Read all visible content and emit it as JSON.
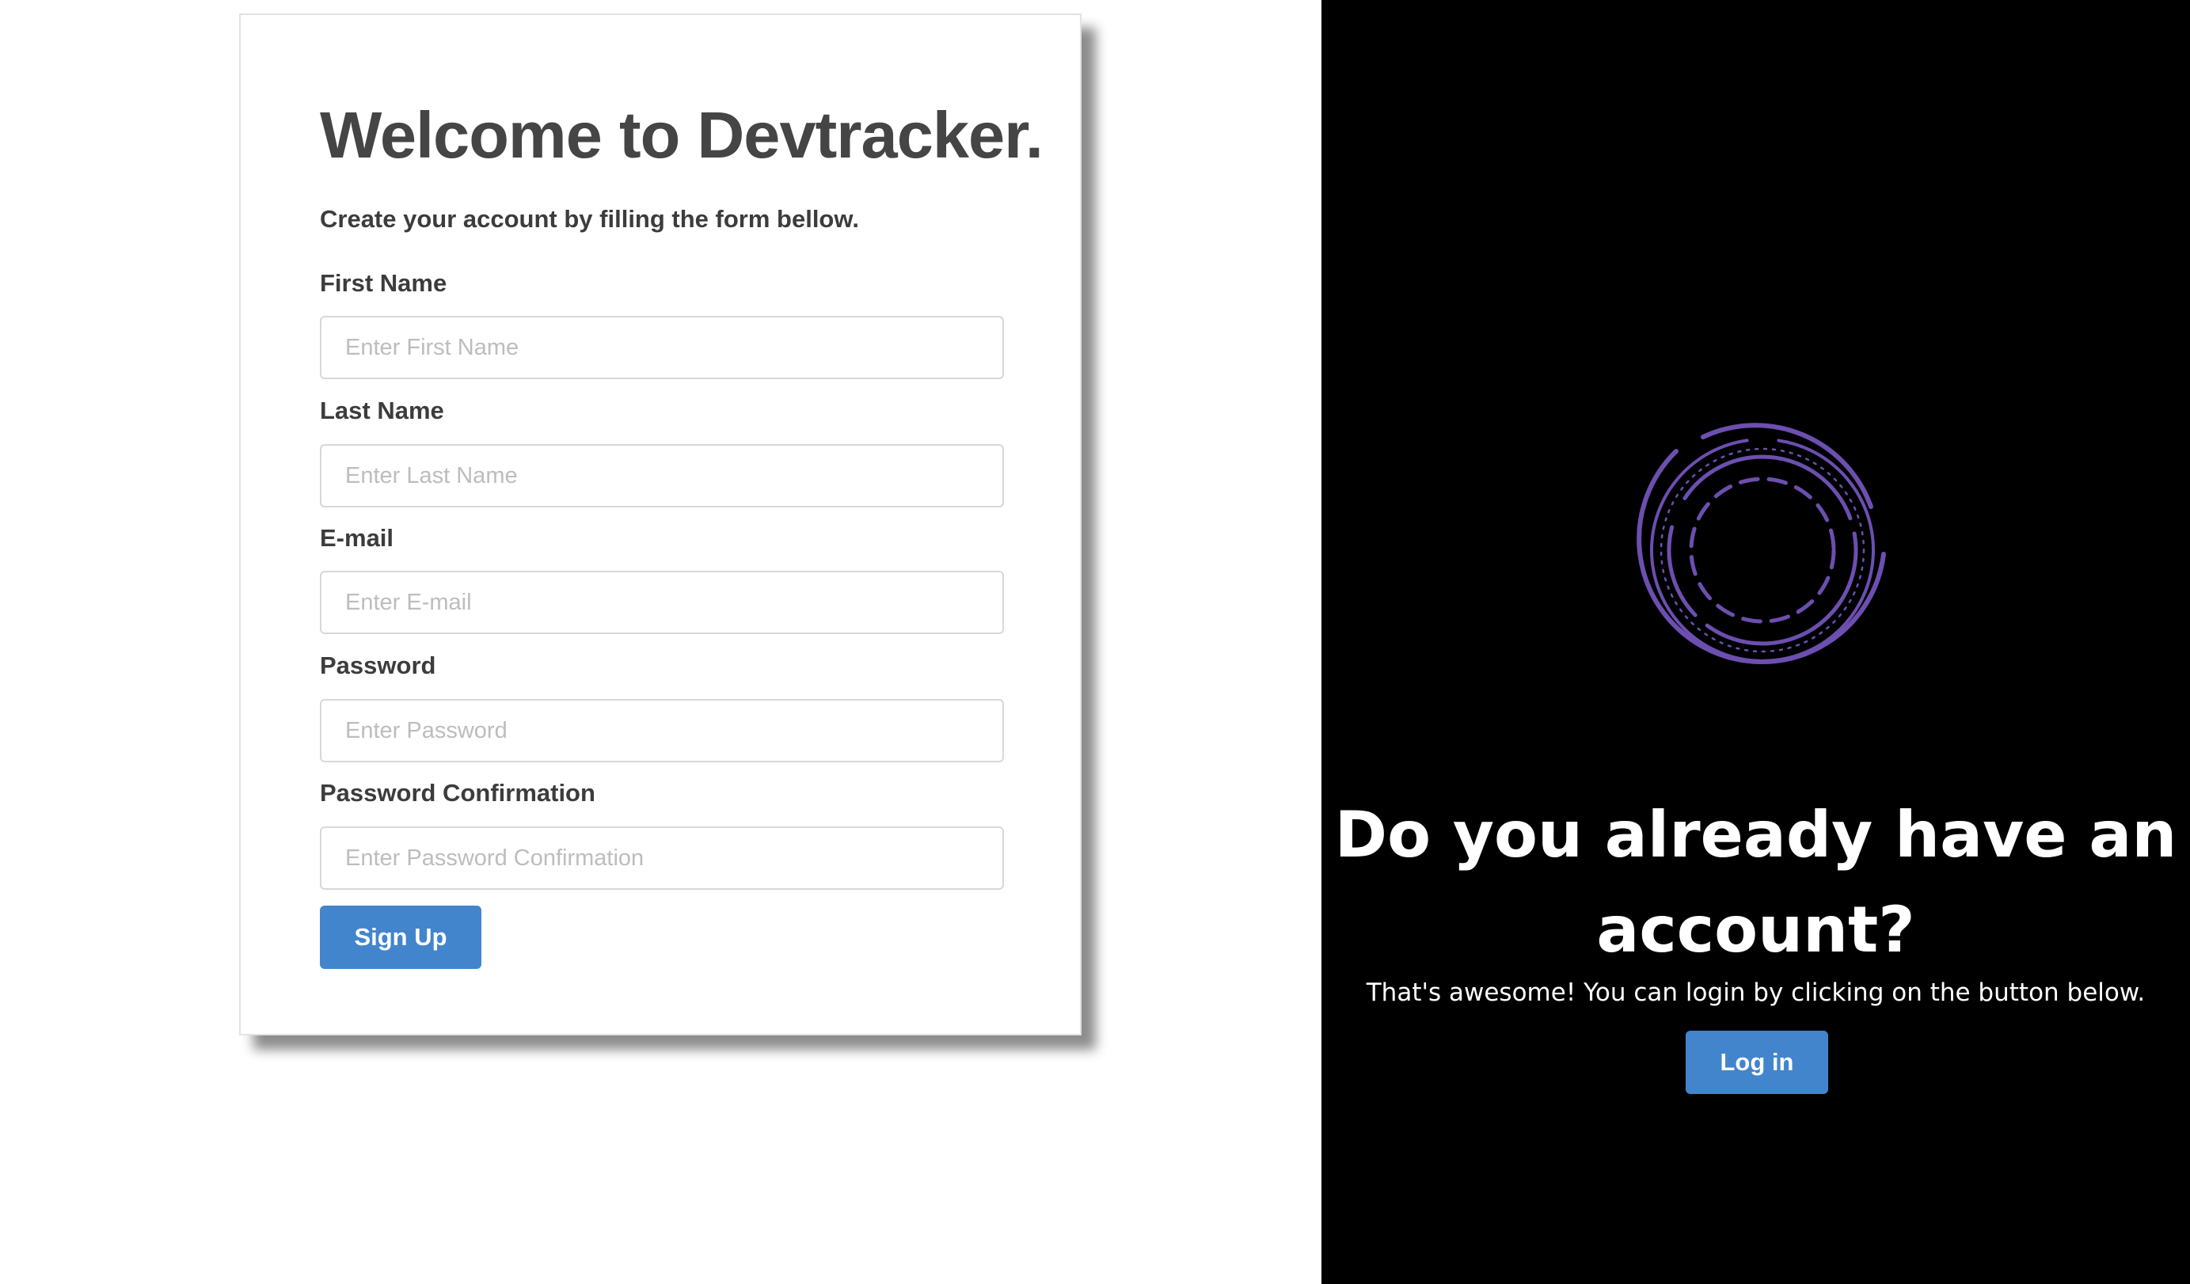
{
  "signup": {
    "title": "Welcome to Devtracker.",
    "subtitle": "Create your account by filling the form bellow.",
    "fields": [
      {
        "label": "First Name",
        "placeholder": "Enter First Name",
        "value": ""
      },
      {
        "label": "Last Name",
        "placeholder": "Enter Last Name",
        "value": ""
      },
      {
        "label": "E-mail",
        "placeholder": "Enter E-mail",
        "value": ""
      },
      {
        "label": "Password",
        "placeholder": "Enter Password",
        "value": ""
      },
      {
        "label": "Password Confirmation",
        "placeholder": "Enter Password Confirmation",
        "value": ""
      }
    ],
    "submit_label": "Sign Up"
  },
  "login": {
    "title": "Do you already have an account?",
    "subtitle": "That's awesome! You can login by clicking on the button below.",
    "button_label": "Log in",
    "logo_icon": "concentric-rings-logo-icon"
  },
  "colors": {
    "accent": "#4285cc",
    "logo": "#6c4fb0",
    "right_bg": "#000000",
    "text_dark": "#454545"
  }
}
